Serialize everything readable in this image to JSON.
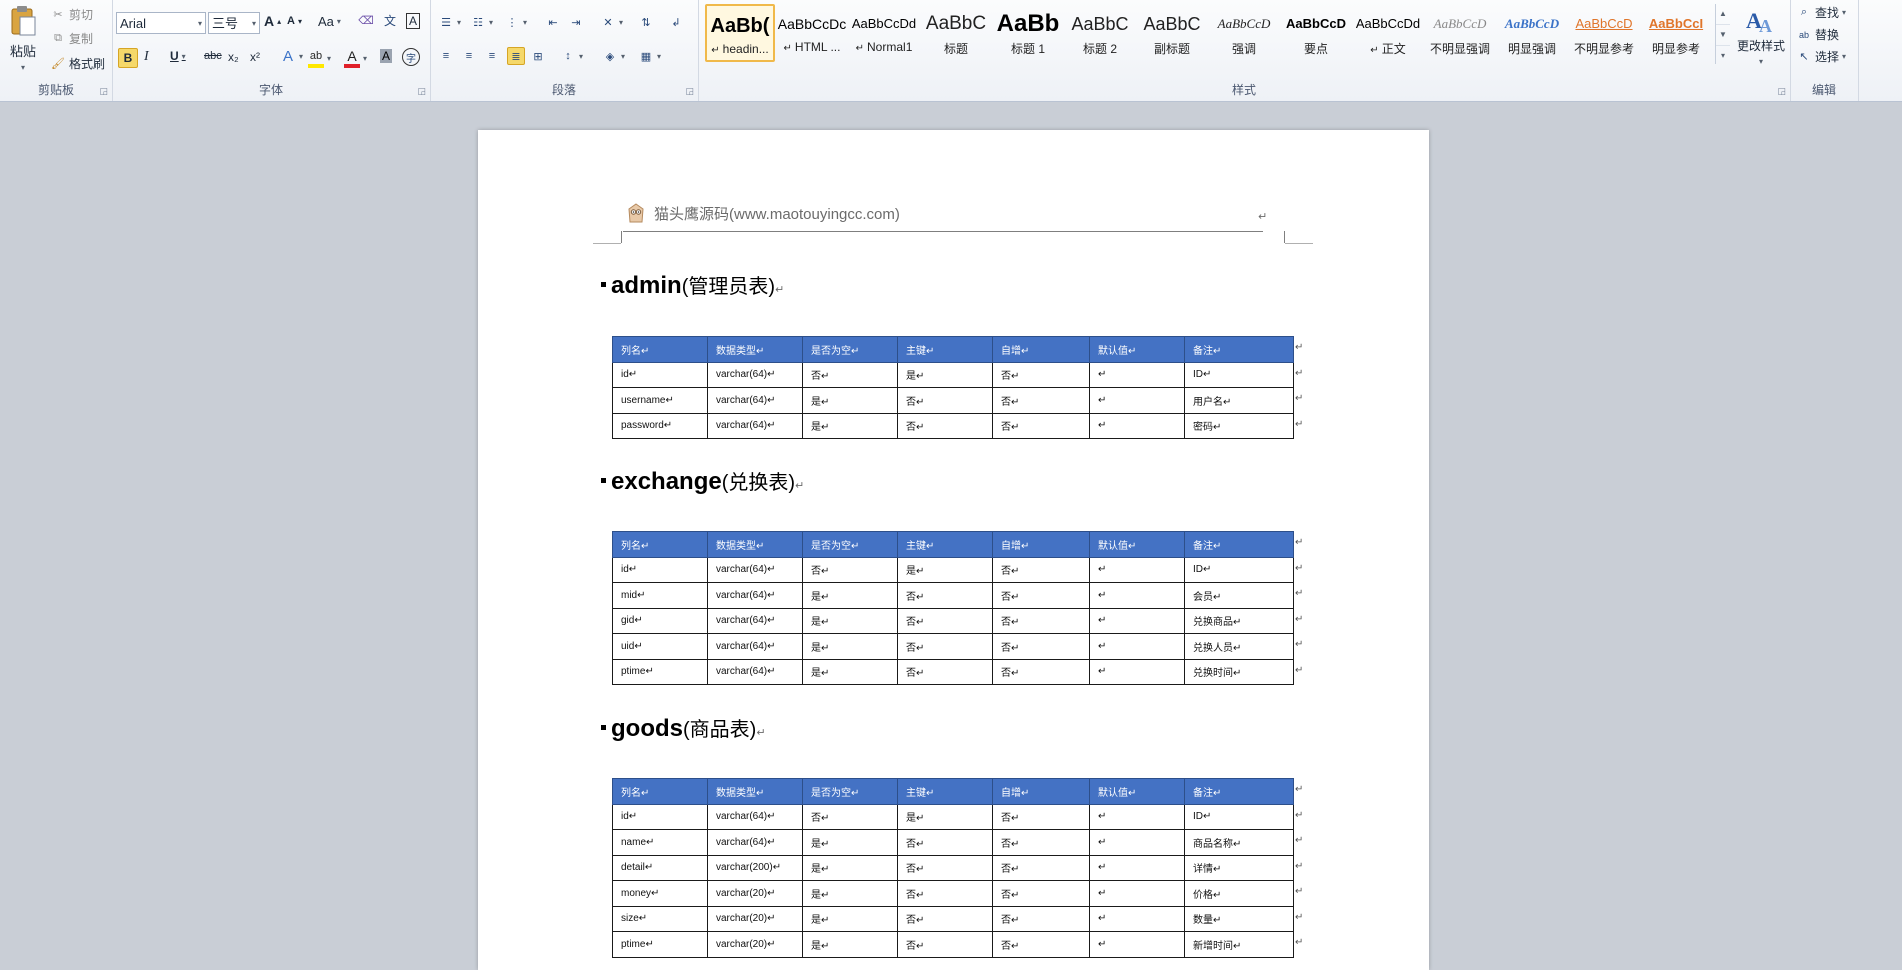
{
  "ribbon": {
    "clipboard": {
      "label": "剪贴板",
      "paste": "粘贴",
      "cut": "剪切",
      "copy": "复制",
      "format_painter": "格式刷"
    },
    "font": {
      "label": "字体",
      "font_name": "Arial",
      "font_size": "三号",
      "bold": "B",
      "italic": "I",
      "underline": "U",
      "strikethrough": "abc",
      "subscript": "x₂",
      "superscript": "x²",
      "grow": "A",
      "shrink": "A",
      "change_case": "Aa",
      "char_border": "A"
    },
    "paragraph": {
      "label": "段落"
    },
    "styles": {
      "label": "样式",
      "change_styles": "更改样式",
      "items": [
        {
          "sample": "AaBb(",
          "name": "headin...",
          "selected": true,
          "font": "bold",
          "size": 20,
          "color": "#000000",
          "prefix": "↵"
        },
        {
          "sample": "AaBbCcDc",
          "name": "HTML ...",
          "font": "normal",
          "size": 14,
          "color": "#000000",
          "prefix": "↵"
        },
        {
          "sample": "AaBbCcDd",
          "name": "Normal1",
          "font": "normal",
          "size": 13,
          "color": "#000000",
          "prefix": "↵"
        },
        {
          "sample": "AaBbC",
          "name": "标题",
          "font": "normal",
          "size": 19,
          "color": "#222222"
        },
        {
          "sample": "AaBb",
          "name": "标题 1",
          "font": "bold",
          "size": 24,
          "color": "#000000"
        },
        {
          "sample": "AaBbC",
          "name": "标题 2",
          "font": "normal",
          "size": 18,
          "color": "#222222"
        },
        {
          "sample": "AaBbC",
          "name": "副标题",
          "font": "normal",
          "size": 18,
          "color": "#222222"
        },
        {
          "sample": "AaBbCcD",
          "name": "强调",
          "font": "italic",
          "size": 13,
          "color": "#222222"
        },
        {
          "sample": "AaBbCcD",
          "name": "要点",
          "font": "bold",
          "size": 13,
          "color": "#000000"
        },
        {
          "sample": "AaBbCcDd",
          "name": "正文",
          "font": "normal",
          "size": 13,
          "color": "#000000",
          "prefix": "↵"
        },
        {
          "sample": "AaBbCcD",
          "name": "不明显强调",
          "font": "italic",
          "size": 13,
          "color": "#888888"
        },
        {
          "sample": "AaBbCcD",
          "name": "明显强调",
          "font": "bold-italic",
          "size": 13,
          "color": "#3b73c8"
        },
        {
          "sample": "AaBbCcD",
          "name": "不明显参考",
          "font": "underline",
          "size": 13,
          "color": "#e0752a"
        },
        {
          "sample": "AaBbCcI",
          "name": "明显参考",
          "font": "bold-underline",
          "size": 13,
          "color": "#e0752a"
        }
      ]
    },
    "editing": {
      "label": "编辑",
      "find": "查找",
      "replace": "替换",
      "select": "选择"
    }
  },
  "document": {
    "header_text": "猫头鹰源码(www.maotouyingcc.com)",
    "return_mark": "↵",
    "sections": [
      {
        "title_en": "admin",
        "title_zh": "(管理员表)",
        "columns": [
          "列名↵",
          "数据类型↵",
          "是否为空↵",
          "主键↵",
          "自增↵",
          "默认值↵",
          "备注↵"
        ],
        "rows": [
          [
            "id↵",
            "varchar(64)↵",
            "否↵",
            "是↵",
            "否↵",
            "↵",
            "ID↵"
          ],
          [
            "username↵",
            "varchar(64)↵",
            "是↵",
            "否↵",
            "否↵",
            "↵",
            "用户名↵"
          ],
          [
            "password↵",
            "varchar(64)↵",
            "是↵",
            "否↵",
            "否↵",
            "↵",
            "密码↵"
          ]
        ]
      },
      {
        "title_en": "exchange",
        "title_zh": "(兑换表)",
        "columns": [
          "列名↵",
          "数据类型↵",
          "是否为空↵",
          "主键↵",
          "自增↵",
          "默认值↵",
          "备注↵"
        ],
        "rows": [
          [
            "id↵",
            "varchar(64)↵",
            "否↵",
            "是↵",
            "否↵",
            "↵",
            "ID↵"
          ],
          [
            "mid↵",
            "varchar(64)↵",
            "是↵",
            "否↵",
            "否↵",
            "↵",
            "会员↵"
          ],
          [
            "gid↵",
            "varchar(64)↵",
            "是↵",
            "否↵",
            "否↵",
            "↵",
            "兑换商品↵"
          ],
          [
            "uid↵",
            "varchar(64)↵",
            "是↵",
            "否↵",
            "否↵",
            "↵",
            "兑换人员↵"
          ],
          [
            "ptime↵",
            "varchar(64)↵",
            "是↵",
            "否↵",
            "否↵",
            "↵",
            "兑换时间↵"
          ]
        ]
      },
      {
        "title_en": "goods",
        "title_zh": "(商品表)",
        "columns": [
          "列名↵",
          "数据类型↵",
          "是否为空↵",
          "主键↵",
          "自增↵",
          "默认值↵",
          "备注↵"
        ],
        "rows": [
          [
            "id↵",
            "varchar(64)↵",
            "否↵",
            "是↵",
            "否↵",
            "↵",
            "ID↵"
          ],
          [
            "name↵",
            "varchar(64)↵",
            "是↵",
            "否↵",
            "否↵",
            "↵",
            "商品名称↵"
          ],
          [
            "detail↵",
            "varchar(200)↵",
            "是↵",
            "否↵",
            "否↵",
            "↵",
            "详情↵"
          ],
          [
            "money↵",
            "varchar(20)↵",
            "是↵",
            "否↵",
            "否↵",
            "↵",
            "价格↵"
          ],
          [
            "size↵",
            "varchar(20)↵",
            "是↵",
            "否↵",
            "否↵",
            "↵",
            "数量↵"
          ],
          [
            "ptime↵",
            "varchar(20)↵",
            "是↵",
            "否↵",
            "否↵",
            "↵",
            "新增时间↵"
          ]
        ]
      }
    ]
  },
  "colors": {
    "table_header_bg": "#4472c4",
    "table_header_text": "#ffffff",
    "workspace_bg": "#c9ced6",
    "selected_style_border": "#f0b94a"
  }
}
